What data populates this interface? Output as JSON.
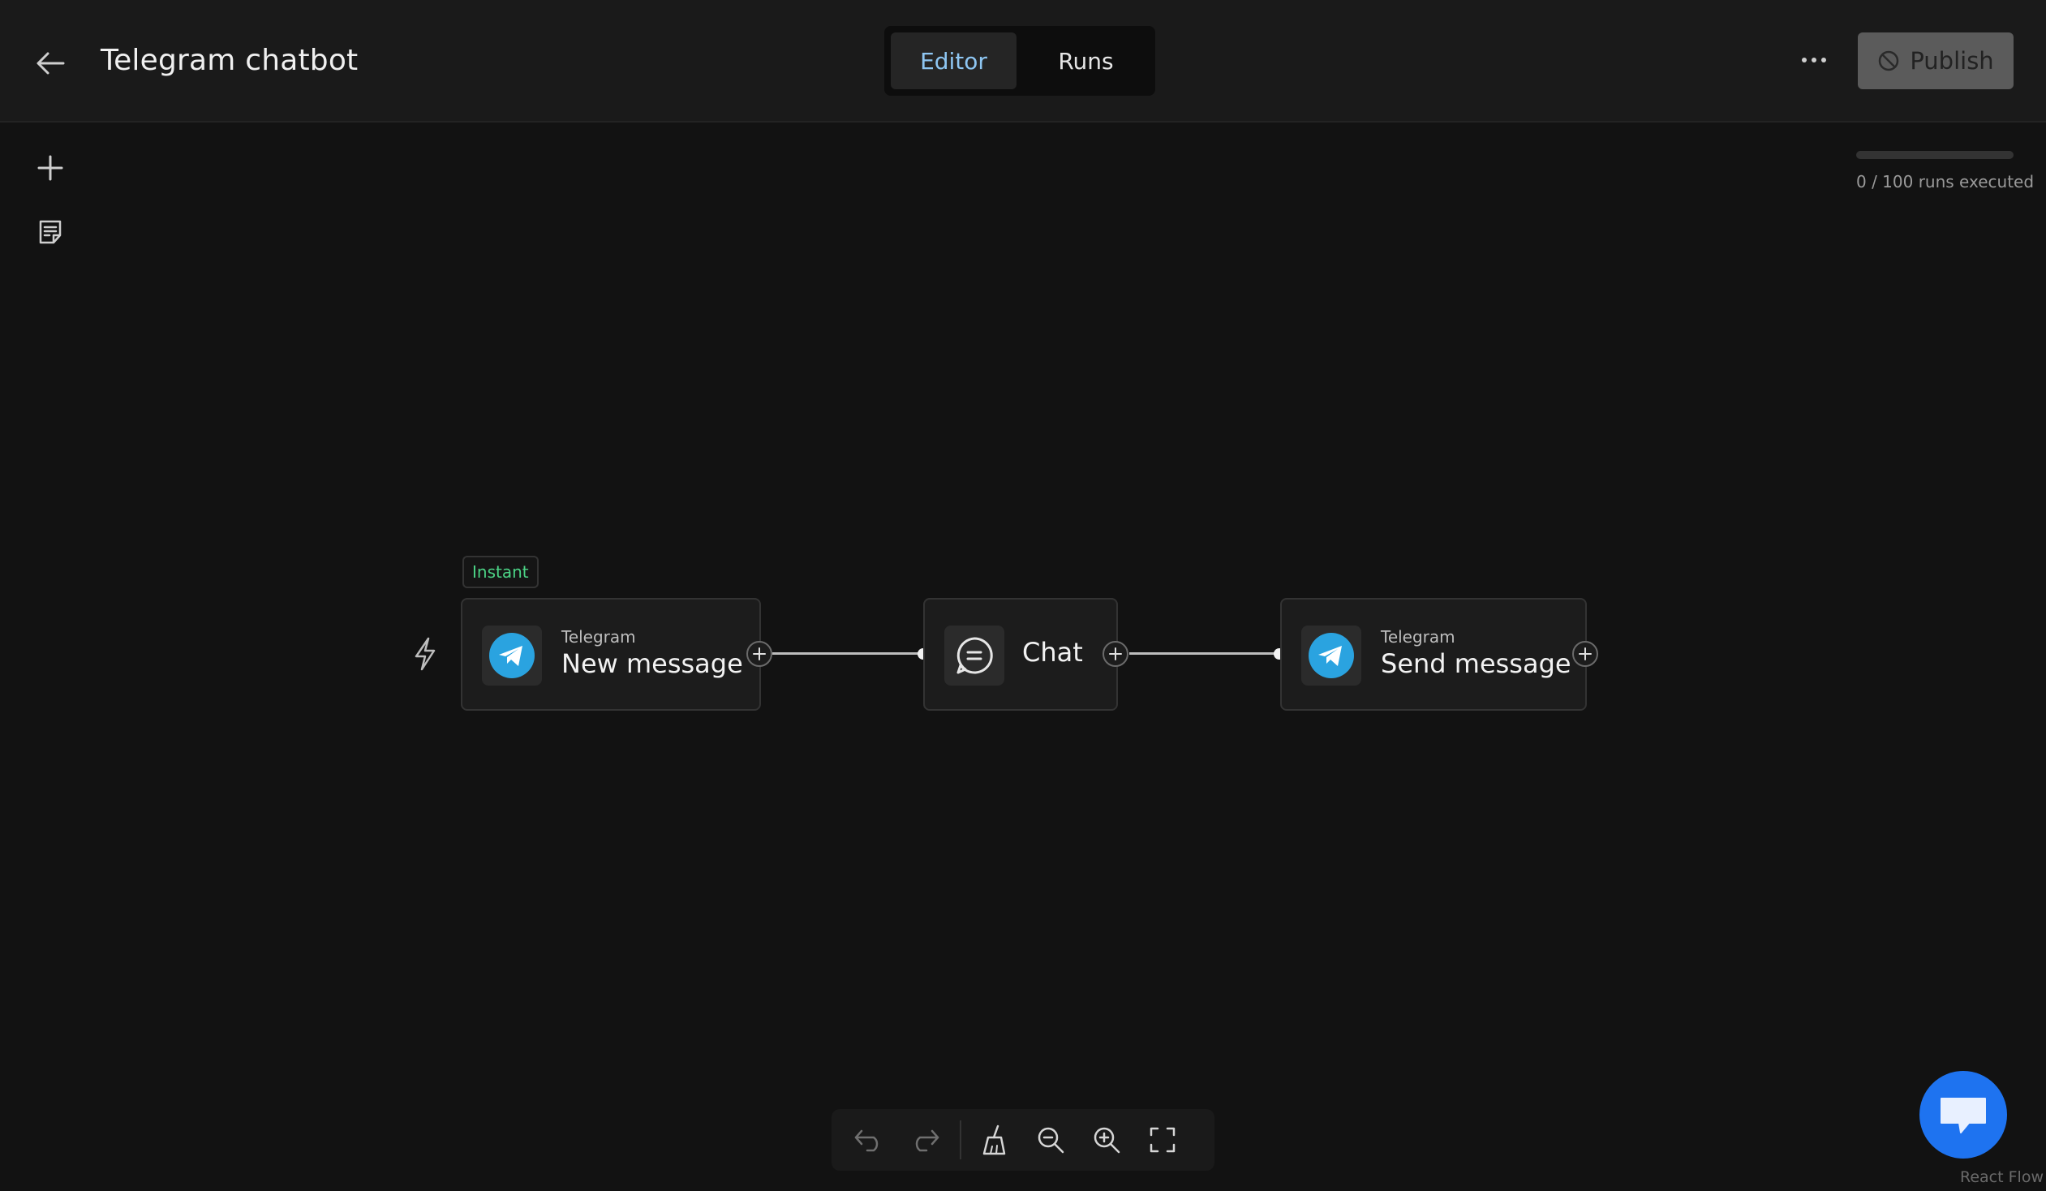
{
  "header": {
    "title": "Telegram chatbot",
    "tabs": [
      {
        "label": "Editor",
        "active": true
      },
      {
        "label": "Runs",
        "active": false
      }
    ],
    "publish_label": "Publish"
  },
  "usage": {
    "text": "0 / 100 runs executed",
    "used": 0,
    "limit": 100
  },
  "flow": {
    "badge": "Instant",
    "nodes": [
      {
        "app": "Telegram",
        "label": "New message"
      },
      {
        "app": "",
        "label": "Chat"
      },
      {
        "app": "Telegram",
        "label": "Send message"
      }
    ]
  },
  "attribution": "React Flow",
  "colors": {
    "accent": "#8ec6f2",
    "telegram": "#2aa3e0",
    "instant": "#4cd486",
    "fab": "#1e73f0"
  },
  "icons": [
    "back-arrow-icon",
    "more-icon",
    "disabled-icon",
    "plus-icon",
    "note-icon",
    "lightning-icon",
    "telegram-icon",
    "chat-icon",
    "undo-icon",
    "redo-icon",
    "broom-icon",
    "zoom-out-icon",
    "zoom-in-icon",
    "fullscreen-icon",
    "chat-bubble-icon"
  ]
}
